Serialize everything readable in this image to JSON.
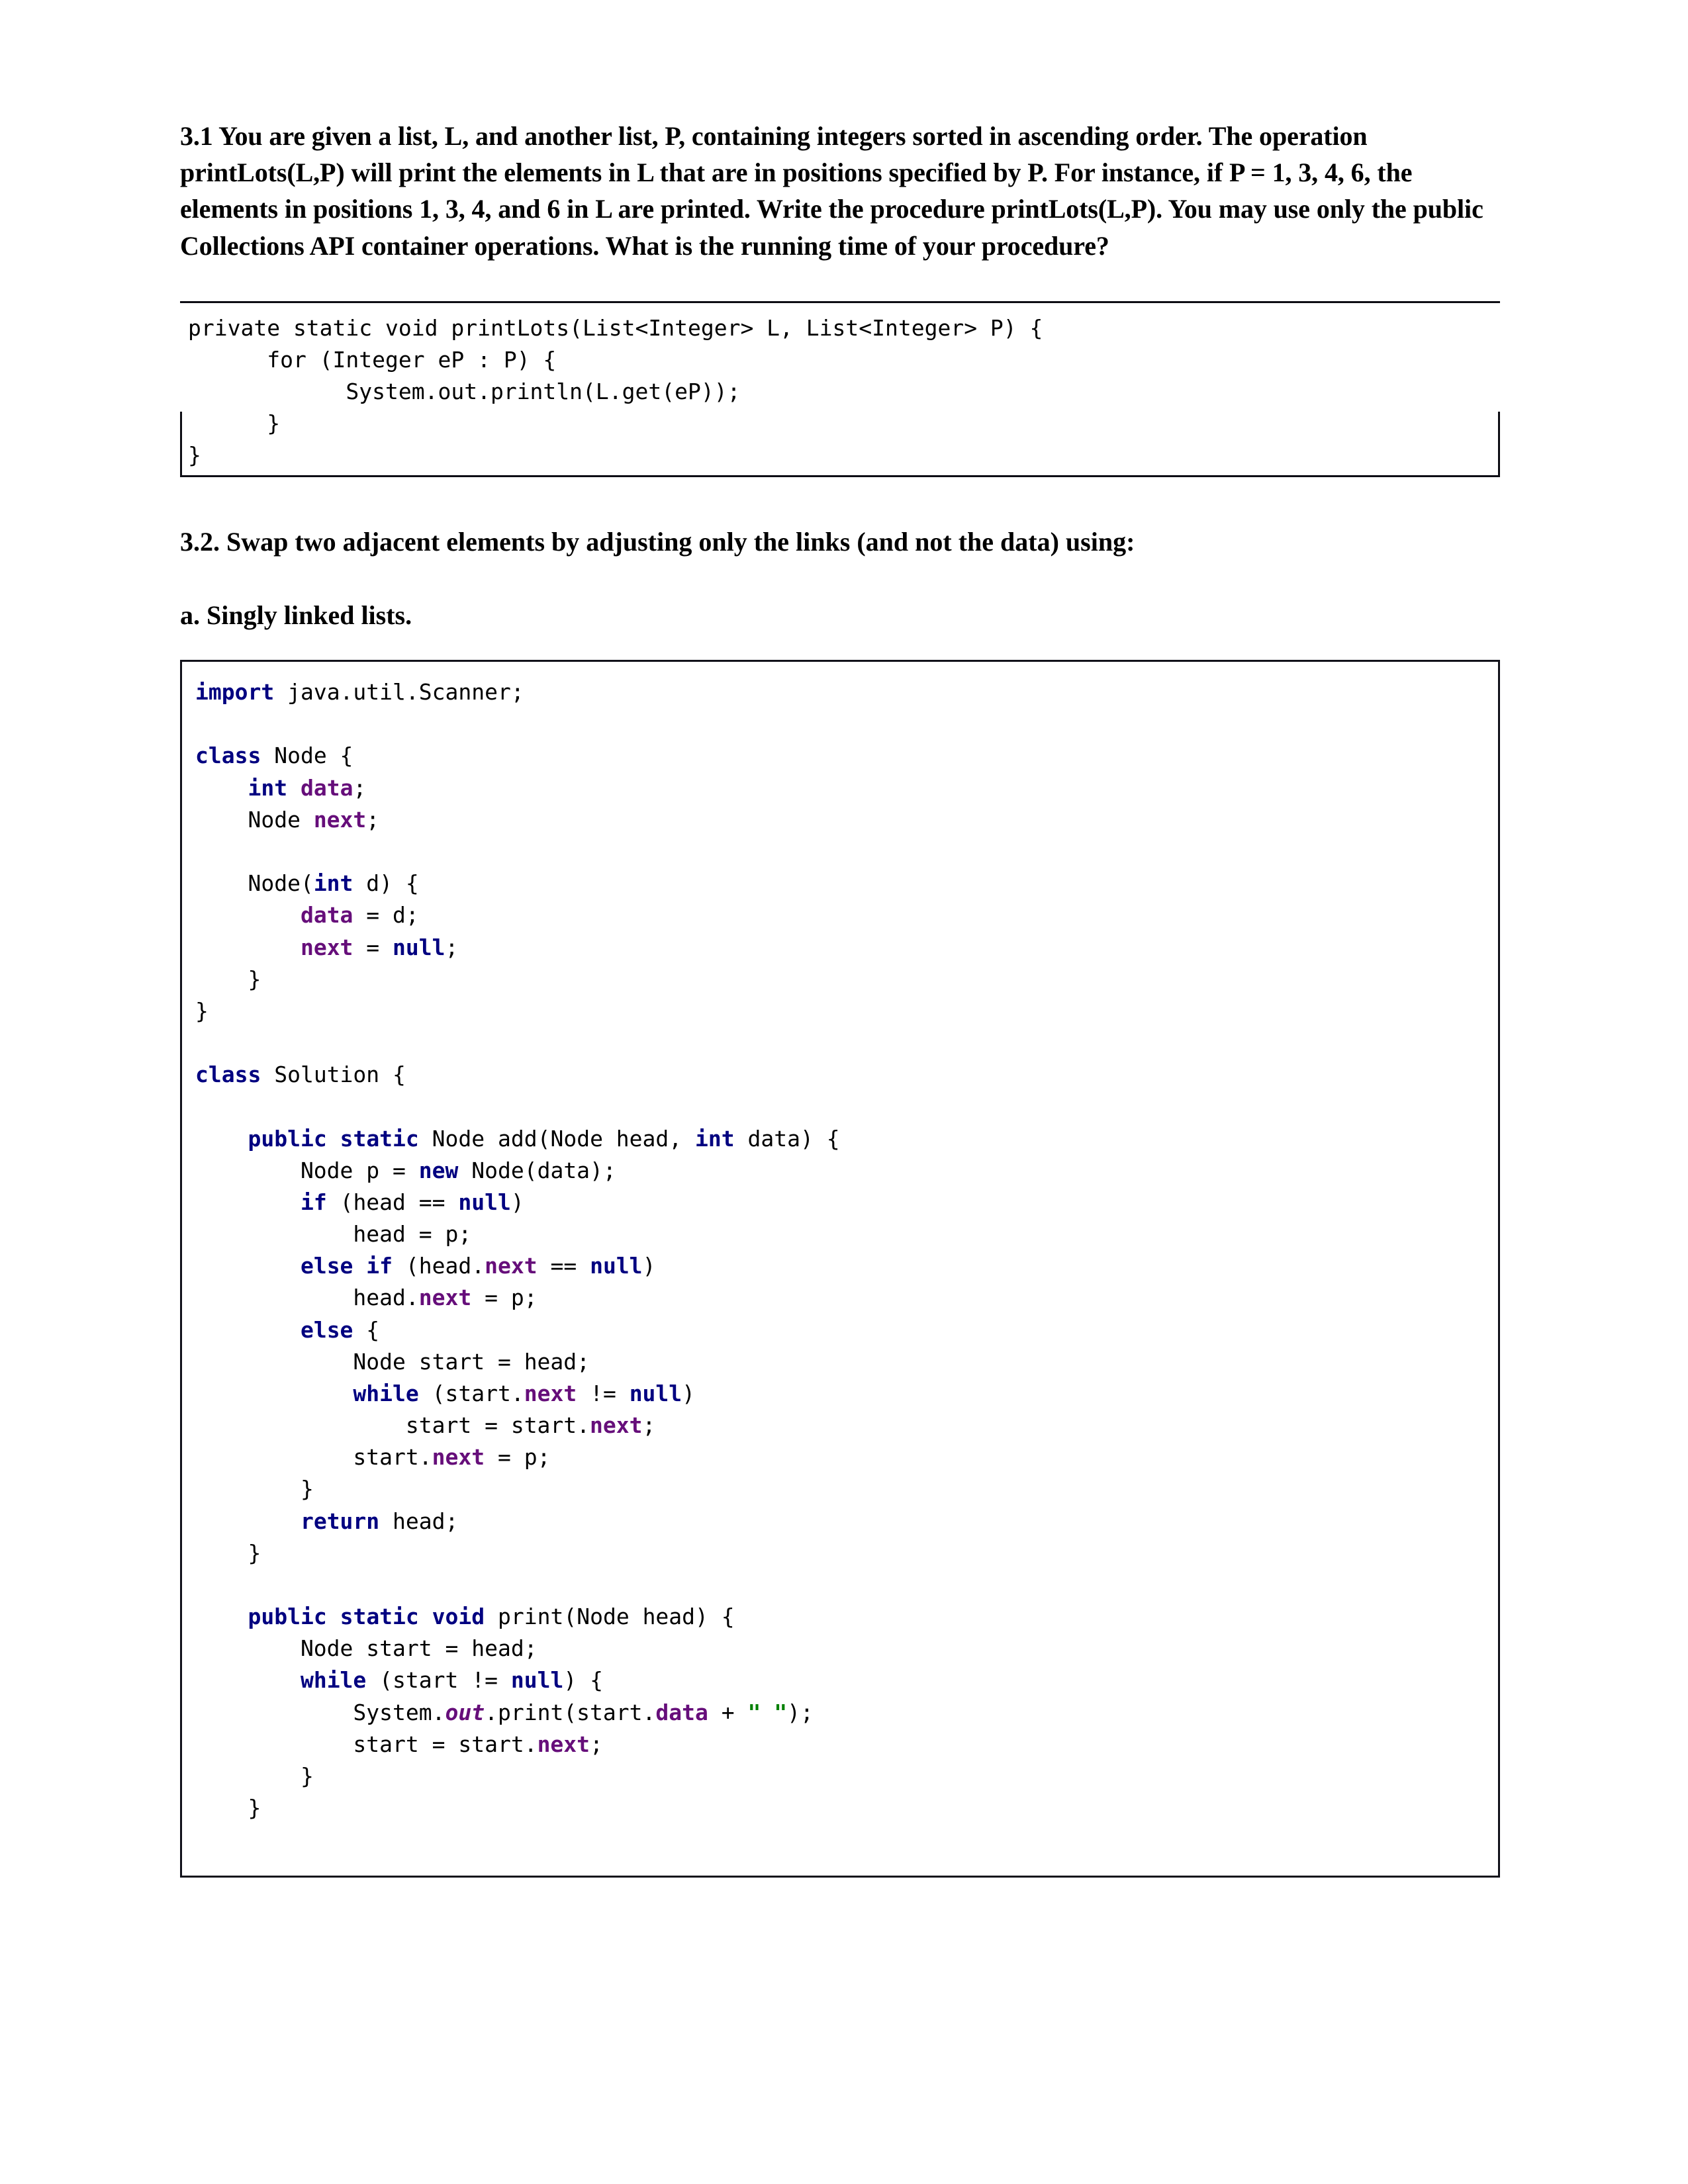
{
  "document": {
    "question_3_1": {
      "text": "3.1 You are given a list, L, and another list, P, containing integers sorted in ascending order. The operation printLots(L,P) will print the elements in L that are in positions specified by P. For instance, if P = 1, 3, 4, 6, the elements in positions 1, 3, 4, and 6 in L are printed. Write the procedure printLots(L,P). You may use only the public Collections API container operations. What is the running time of your procedure?"
    },
    "code_block_1": {
      "language": "java",
      "lines": [
        "private static void printLots(List<Integer> L, List<Integer> P) {",
        "      for (Integer eP : P) {",
        "            System.out.println(L.get(eP));",
        "      }",
        "}"
      ],
      "text": "private static void printLots(List<Integer> L, List<Integer> P) {\n      for (Integer eP : P) {\n            System.out.println(L.get(eP));\n      }\n}"
    },
    "question_3_2": {
      "text": "3.2. Swap two adjacent elements by adjusting only the links (and not the data) using:"
    },
    "subquestion_a": {
      "text": "a. Singly linked lists."
    },
    "code_block_2": {
      "language": "java",
      "lines": [
        "import java.util.Scanner;",
        "",
        "class Node {",
        "    int data;",
        "    Node next;",
        "",
        "    Node(int d) {",
        "        data = d;",
        "        next = null;",
        "    }",
        "}",
        "",
        "class Solution {",
        "",
        "    public static Node add(Node head, int data) {",
        "        Node p = new Node(data);",
        "        if (head == null)",
        "            head = p;",
        "        else if (head.next == null)",
        "            head.next = p;",
        "        else {",
        "            Node start = head;",
        "            while (start.next != null)",
        "                start = start.next;",
        "            start.next = p;",
        "        }",
        "        return head;",
        "    }",
        "",
        "    public static void print(Node head) {",
        "        Node start = head;",
        "        while (start != null) {",
        "            System.out.print(start.data + \" \");",
        "            start = start.next;",
        "        }",
        "    }"
      ],
      "keywords": [
        "import",
        "class",
        "int",
        "new",
        "if",
        "else",
        "while",
        "return",
        "public",
        "static",
        "void",
        "null"
      ],
      "fields": [
        "data",
        "next",
        "out"
      ],
      "strings": [
        "\" \""
      ]
    },
    "colors": {
      "keyword": "#000080",
      "field": "#660e7a",
      "string": "#008000",
      "text": "#000000",
      "border": "#11111a",
      "background": "#ffffff"
    }
  }
}
